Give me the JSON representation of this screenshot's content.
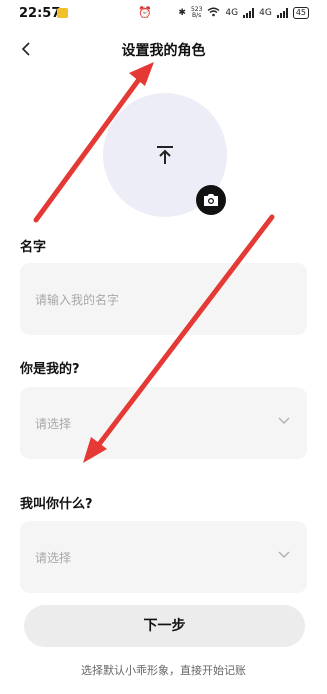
{
  "status_bar": {
    "time": "22:57",
    "network_speed_value": "523",
    "network_speed_unit": "B/s",
    "signal_1_label": "4G",
    "signal_2_label": "4G",
    "battery": "45"
  },
  "header": {
    "back_icon": "chevron-left-icon",
    "title": "设置我的角色"
  },
  "avatar": {
    "upload_icon": "upload-icon",
    "camera_icon": "camera-icon"
  },
  "form": {
    "name": {
      "label": "名字",
      "placeholder": "请输入我的名字"
    },
    "relation": {
      "label": "你是我的?",
      "placeholder": "请选择"
    },
    "nickname": {
      "label": "我叫你什么?",
      "placeholder": "请选择"
    }
  },
  "actions": {
    "next_label": "下一步",
    "footer_text": "选择默认小乖形象，直接开始记账"
  },
  "colors": {
    "avatar_bg": "#ededf7",
    "field_bg": "#f5f5f5",
    "button_bg": "#ececec",
    "annotation_arrow": "#e53935"
  }
}
